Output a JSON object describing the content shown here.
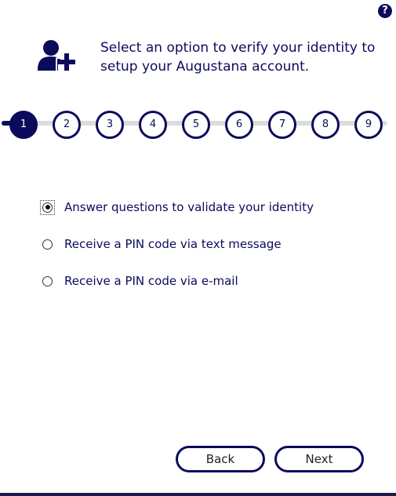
{
  "help": {
    "icon": "question-circle-icon",
    "glyph": "?"
  },
  "header": {
    "icon": "user-plus-icon",
    "text": "Select an option to verify your identity to setup your Augustana account."
  },
  "stepper": {
    "current_step": 1,
    "steps": [
      {
        "label": "1",
        "active": true
      },
      {
        "label": "2",
        "active": false
      },
      {
        "label": "3",
        "active": false
      },
      {
        "label": "4",
        "active": false
      },
      {
        "label": "5",
        "active": false
      },
      {
        "label": "6",
        "active": false
      },
      {
        "label": "7",
        "active": false
      },
      {
        "label": "8",
        "active": false
      },
      {
        "label": "9",
        "active": false
      }
    ]
  },
  "options": [
    {
      "label": "Answer questions to validate your identity",
      "selected": true
    },
    {
      "label": "Receive a PIN code via text message",
      "selected": false
    },
    {
      "label": "Receive a PIN code via e-mail",
      "selected": false
    }
  ],
  "buttons": {
    "back": "Back",
    "next": "Next"
  },
  "colors": {
    "primary": "#0b0b5c",
    "track": "#dcdcdc"
  }
}
